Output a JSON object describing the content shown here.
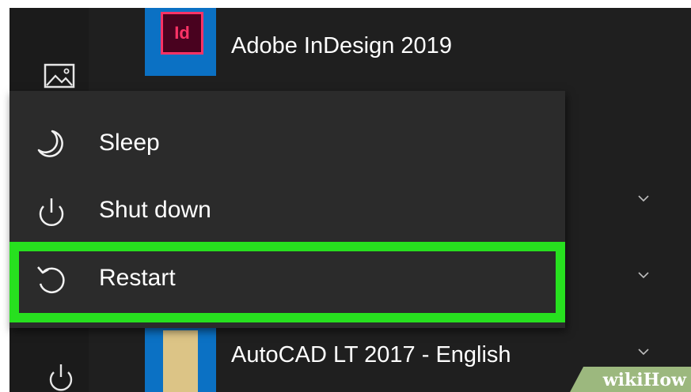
{
  "apps": {
    "indesign": {
      "logo_text": "Id",
      "label": "Adobe InDesign 2019"
    },
    "autocad": {
      "label": "AutoCAD LT 2017 - English"
    }
  },
  "power_menu": {
    "items": [
      {
        "label": "Sleep",
        "icon": "moon-icon"
      },
      {
        "label": "Shut down",
        "icon": "power-icon"
      },
      {
        "label": "Restart",
        "icon": "restart-icon"
      }
    ],
    "highlighted_item": "Restart",
    "highlight_color": "#27e01f"
  },
  "rail": {
    "icons": [
      "pictures-icon",
      "power-icon"
    ]
  },
  "colors": {
    "tile_blue": "#0b71c4",
    "menu_bg": "#2b2b2b",
    "indesign_accent": "#ff3366"
  },
  "watermark": {
    "part1": "wiki",
    "part2": "How"
  }
}
